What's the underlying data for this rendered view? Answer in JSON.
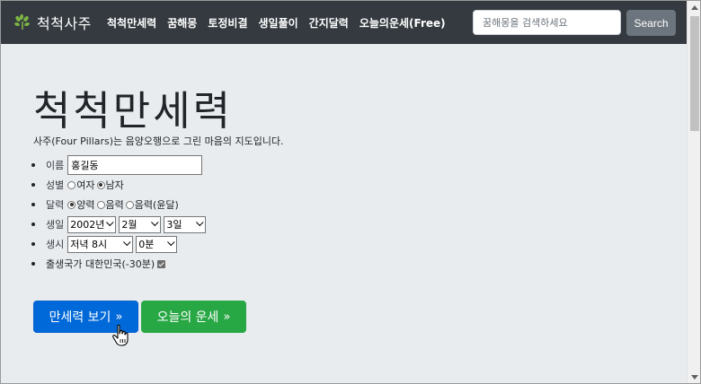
{
  "navbar": {
    "brand": "척척사주",
    "brand_icon": "leaf-sprout-icon",
    "links": [
      "척척만세력",
      "꿈해몽",
      "토정비결",
      "생일풀이",
      "간지달력",
      "오늘의운세(Free)"
    ],
    "search_placeholder": "꿈해몽을 검색하세요",
    "search_button": "Search"
  },
  "main": {
    "title": "척척만세력",
    "lead": "사주(Four Pillars)는 음양오행으로 그린 마음의 지도입니다.",
    "form": {
      "name_label": "이름",
      "name_value": "홍길동",
      "gender_label": "성별",
      "gender_female": "여자",
      "gender_male": "남자",
      "gender_selected": "남자",
      "calendar_label": "달력",
      "calendar_solar": "양력",
      "calendar_lunar": "음력",
      "calendar_lunar_leap": "음력(윤달)",
      "calendar_selected": "양력",
      "birth_label": "생일",
      "birth_year": "2002년",
      "birth_month": "2월",
      "birth_day": "3일",
      "time_label": "생시",
      "time_hour": "저녁 8시",
      "time_minute": "0분",
      "country_text": "출생국가 대한민국(-30분)",
      "country_checked": true
    },
    "buttons": {
      "manse": "만세력 보기",
      "fortune": "오늘의 운세",
      "arrow": "»"
    }
  },
  "colors": {
    "navbar_bg": "#343a40",
    "jumbotron_bg": "#e9ecef",
    "primary": "#0069d9",
    "success": "#28a745",
    "search_btn": "#6c757d",
    "brand_icon": "#7cb342"
  }
}
